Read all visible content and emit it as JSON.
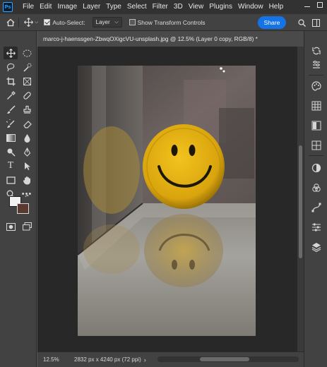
{
  "app": {
    "logo_text": "Ps"
  },
  "menu": [
    "File",
    "Edit",
    "Image",
    "Layer",
    "Type",
    "Select",
    "Filter",
    "3D",
    "View",
    "Plugins",
    "Window",
    "Help"
  ],
  "options_bar": {
    "auto_select_label": "Auto-Select:",
    "auto_select_checked": true,
    "layer_select_value": "Layer",
    "transform_controls_label": "Show Transform Controls",
    "transform_controls_checked": false,
    "share_label": "Share",
    "share_color": "#1473e6"
  },
  "document": {
    "tab_title": "marco-j-haenssgen-ZbwqOXigcVU-unsplash.jpg @ 12.5% (Layer 0 copy, RGB/8) *"
  },
  "status": {
    "zoom": "12.5%",
    "doc_info": "2832 px x 4240 px (72 ppi)"
  },
  "colors": {
    "foreground": "#f2f2f2",
    "background": "#5a3a30",
    "ui_dark": "#323232",
    "ui_panel": "#424242",
    "canvas_bg": "#282828"
  },
  "tools": [
    "move-tool",
    "marquee-tool",
    "lasso-tool",
    "quick-select-tool",
    "crop-tool",
    "frame-tool",
    "eyedropper-tool",
    "healing-brush-tool",
    "brush-tool",
    "clone-stamp-tool",
    "history-brush-tool",
    "eraser-tool",
    "gradient-tool",
    "blur-tool",
    "dodge-tool",
    "pen-tool",
    "type-tool",
    "path-select-tool",
    "rectangle-tool",
    "hand-tool",
    "zoom-tool",
    "more-tools",
    "quick-mask",
    "screen-mode"
  ],
  "right_panels": [
    "history-icon",
    "color-icon",
    "swatches-icon",
    "libraries-icon",
    "adjustments-icon",
    "paths-icon",
    "channels-icon",
    "properties-icon",
    "layers-icon"
  ]
}
